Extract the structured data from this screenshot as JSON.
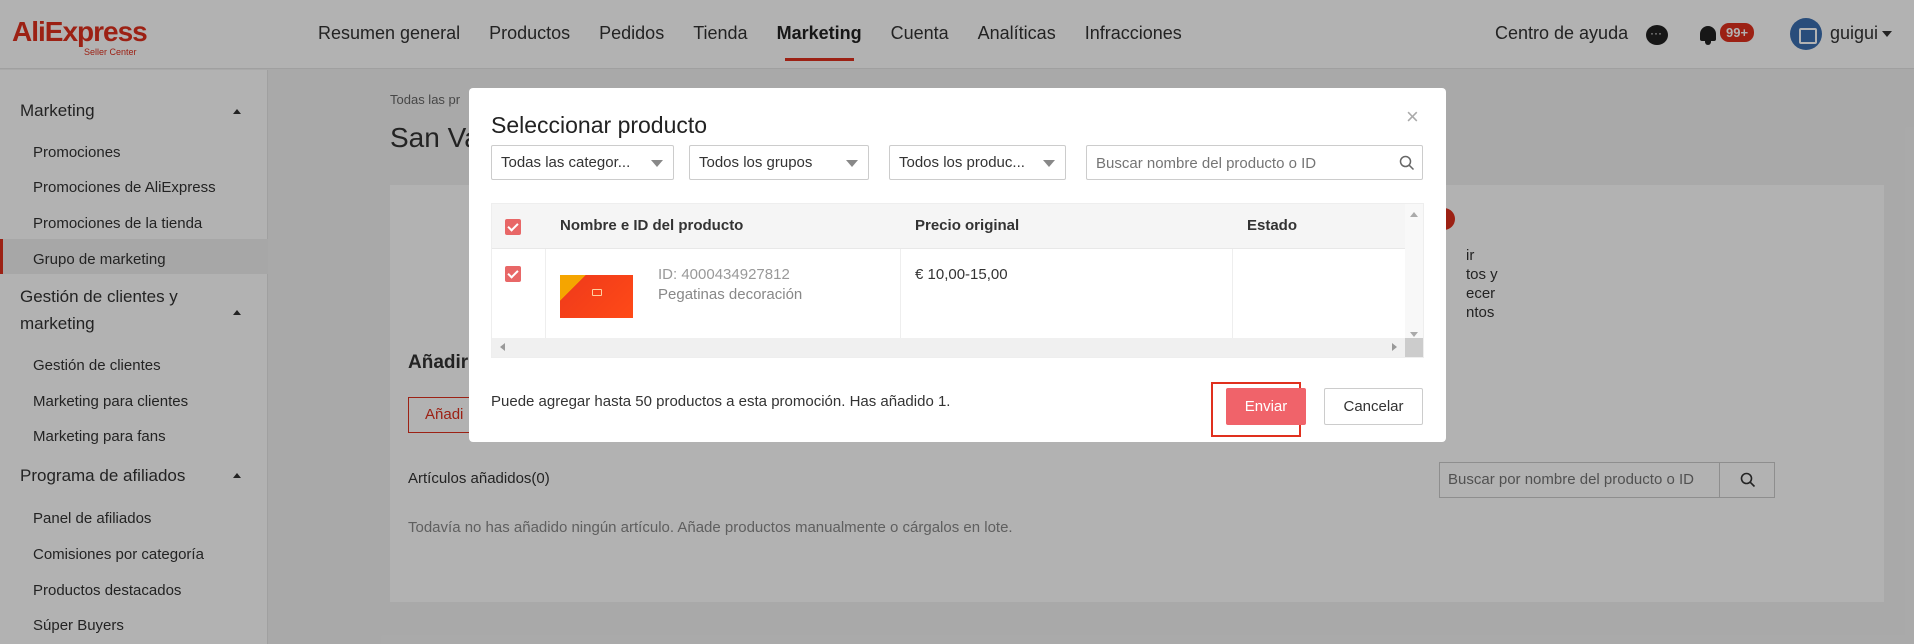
{
  "header": {
    "logo": "AliExpress",
    "logo_sub": "Seller Center",
    "nav": [
      "Resumen general",
      "Productos",
      "Pedidos",
      "Tienda",
      "Marketing",
      "Cuenta",
      "Analíticas",
      "Infracciones"
    ],
    "active_nav": "Marketing",
    "help": "Centro de ayuda",
    "notification_badge": "99+",
    "username": "guigui"
  },
  "sidebar": {
    "groups": [
      {
        "label": "Marketing",
        "items": [
          "Promociones",
          "Promociones de AliExpress",
          "Promociones de la tienda",
          "Grupo de marketing"
        ]
      },
      {
        "label_line1": "Gestión de clientes y",
        "label_line2": "marketing",
        "items": [
          "Gestión de clientes",
          "Marketing para clientes",
          "Marketing para fans"
        ]
      },
      {
        "label": "Programa de afiliados",
        "items": [
          "Panel de afiliados",
          "Comisiones por categoría",
          "Productos destacados",
          "Súper Buyers"
        ]
      }
    ],
    "active_item": "Promociones de AliExpress"
  },
  "page": {
    "breadcrumb": "Todas las pr",
    "title": "San Va",
    "steps_partial": [
      "ir",
      "tos y",
      "ecer",
      "ntos"
    ],
    "add_title": "Añadir",
    "add_button": "Añadi",
    "added_label": "Artículos añadidos(0)",
    "search_placeholder": "Buscar por nombre del producto o ID",
    "empty_text": "Todavía no has añadido ningún artículo. Añade productos manualmente o cárgalos en lote."
  },
  "modal": {
    "title": "Seleccionar producto",
    "close": "×",
    "filters": [
      "Todas las categor...",
      "Todos los grupos",
      "Todos los produc..."
    ],
    "search_placeholder": "Buscar nombre del producto o ID",
    "columns": [
      "Nombre e ID del producto",
      "Precio original",
      "Estado"
    ],
    "rows": [
      {
        "id": "ID: 4000434927812",
        "name": "Pegatinas decoración",
        "price": "€ 10,00-15,00",
        "status": "",
        "checked": true
      }
    ],
    "footer_note": "Puede agregar hasta 50 productos a esta promoción. Has añadido 1.",
    "submit": "Enviar",
    "cancel": "Cancelar"
  },
  "colors": {
    "brand": "#e0301e",
    "submit": "#f0636a",
    "checkbox": "#e86767"
  }
}
